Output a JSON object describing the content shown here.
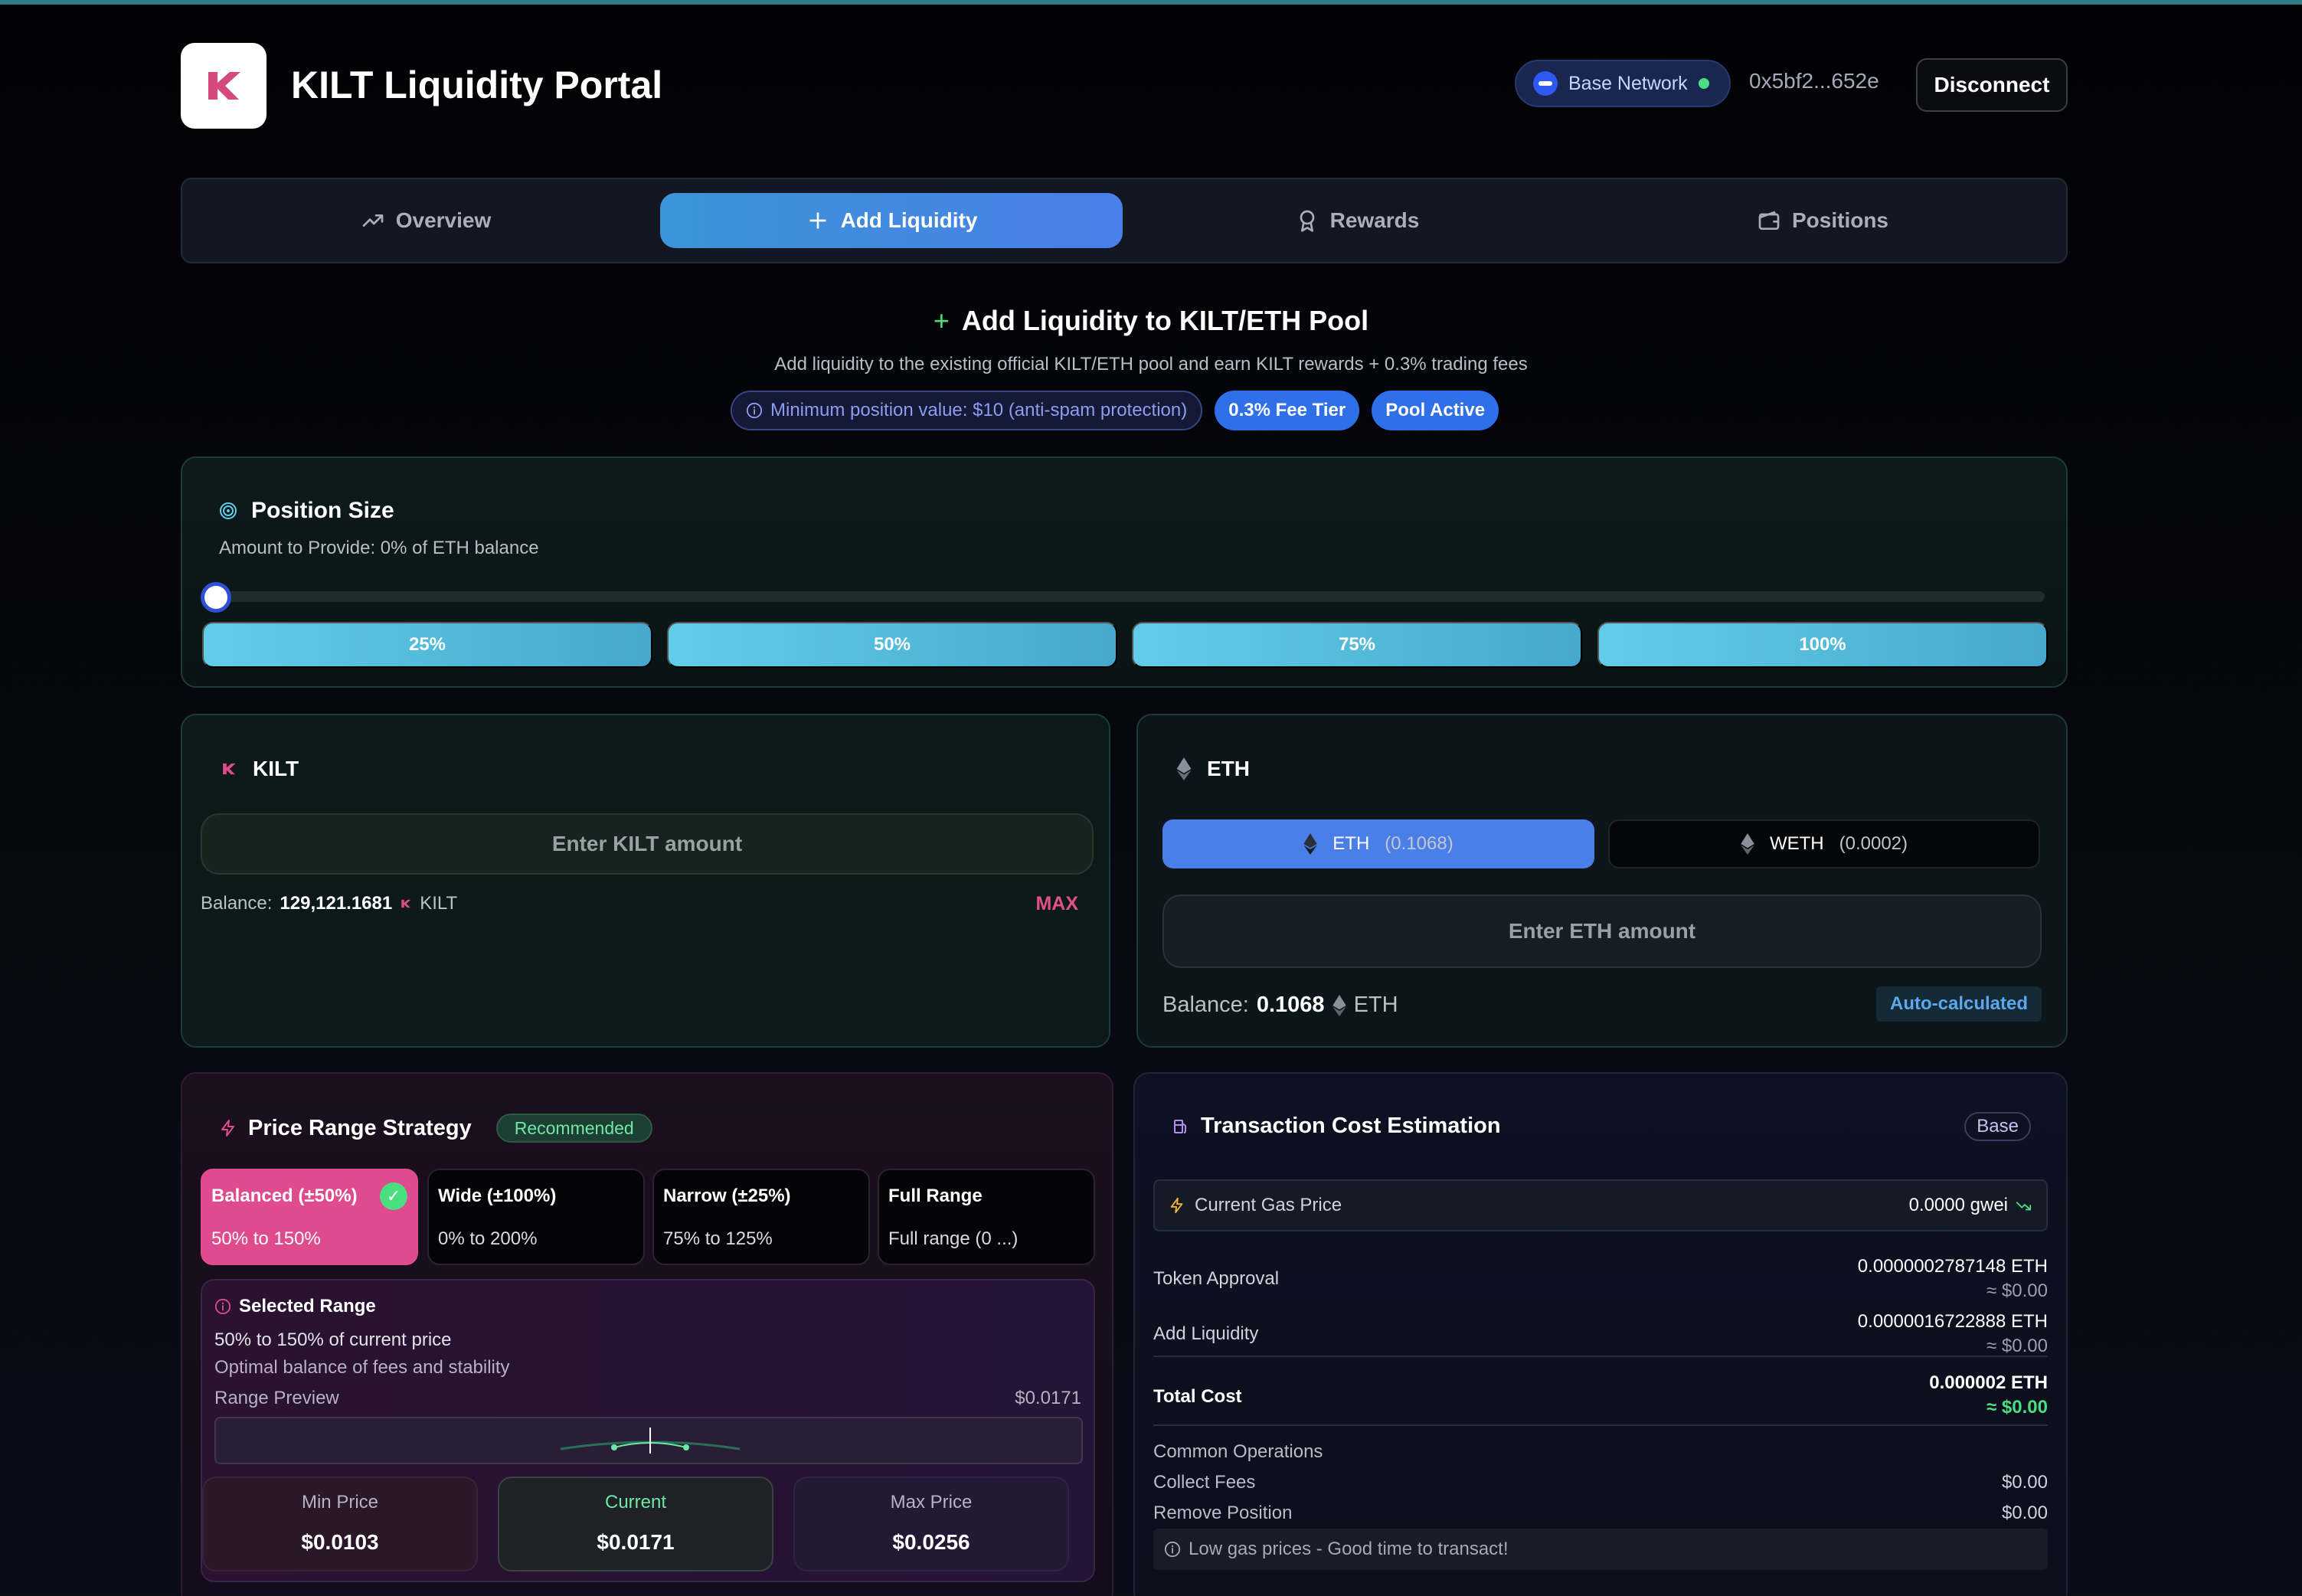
{
  "header": {
    "title": "KILT Liquidity Portal",
    "network": "Base Network",
    "address": "0x5bf2...652e",
    "disconnect_label": "Disconnect"
  },
  "tabs": [
    {
      "label": "Overview",
      "icon": "trending-up-icon"
    },
    {
      "label": "Add Liquidity",
      "icon": "plus-icon",
      "active": true
    },
    {
      "label": "Rewards",
      "icon": "award-icon"
    },
    {
      "label": "Positions",
      "icon": "wallet-icon"
    }
  ],
  "section": {
    "title": "Add Liquidity to KILT/ETH Pool",
    "subtitle": "Add liquidity to the existing official KILT/ETH pool and earn KILT rewards + 0.3% trading fees",
    "min_notice": "Minimum position value: $10 (anti-spam protection)",
    "fee_tier": "0.3% Fee Tier",
    "pool_status": "Pool Active"
  },
  "position": {
    "title": "Position Size",
    "subtitle": "Amount to Provide: 0% of ETH balance",
    "slider_percent": 0,
    "presets": [
      "25%",
      "50%",
      "75%",
      "100%"
    ]
  },
  "kilt": {
    "token": "KILT",
    "placeholder": "Enter KILT amount",
    "balance_label": "Balance:",
    "balance": "129,121.1681",
    "unit": "KILT",
    "max_label": "MAX"
  },
  "eth": {
    "token": "ETH",
    "toggle_eth_label": "ETH",
    "toggle_eth_amount": "(0.1068)",
    "toggle_weth_label": "WETH",
    "toggle_weth_amount": "(0.0002)",
    "placeholder": "Enter ETH amount",
    "balance_label": "Balance:",
    "balance": "0.1068",
    "unit": "ETH",
    "auto_label": "Auto-calculated"
  },
  "range": {
    "title": "Price Range Strategy",
    "badge": "Recommended",
    "strategies": [
      {
        "name": "Balanced (±50%)",
        "range": "50% to 150%",
        "selected": true
      },
      {
        "name": "Wide (±100%)",
        "range": "0% to 200%"
      },
      {
        "name": "Narrow (±25%)",
        "range": "75% to 125%"
      },
      {
        "name": "Full Range",
        "range": "Full range (0 ...)"
      }
    ],
    "selected_title": "Selected Range",
    "selected_desc": "50% to 150% of current price",
    "selected_note": "Optimal balance of fees and stability",
    "preview_label": "Range Preview",
    "preview_price": "$0.0171",
    "min_label": "Min Price",
    "min_value": "$0.0103",
    "current_label": "Current",
    "current_value": "$0.0171",
    "max_label": "Max Price",
    "max_value": "$0.0256"
  },
  "tx": {
    "title": "Transaction Cost Estimation",
    "network_badge": "Base",
    "gas_label": "Current Gas Price",
    "gas_value": "0.0000 gwei",
    "approval_label": "Token Approval",
    "approval_eth": "0.0000002787148 ETH",
    "approval_usd": "≈ $0.00",
    "add_label": "Add Liquidity",
    "add_eth": "0.0000016722888 ETH",
    "add_usd": "≈ $0.00",
    "total_label": "Total Cost",
    "total_eth": "0.000002 ETH",
    "total_usd": "≈ $0.00",
    "ops_label": "Common Operations",
    "collect_label": "Collect Fees",
    "collect_value": "$0.00",
    "remove_label": "Remove Position",
    "remove_value": "$0.00",
    "tip": "Low gas prices - Good time to transact!"
  },
  "colors": {
    "accent_blue": "#4a7ee8",
    "kilt_pink": "#e04a8e",
    "success_green": "#4ade80",
    "cyan": "#62cde8"
  }
}
